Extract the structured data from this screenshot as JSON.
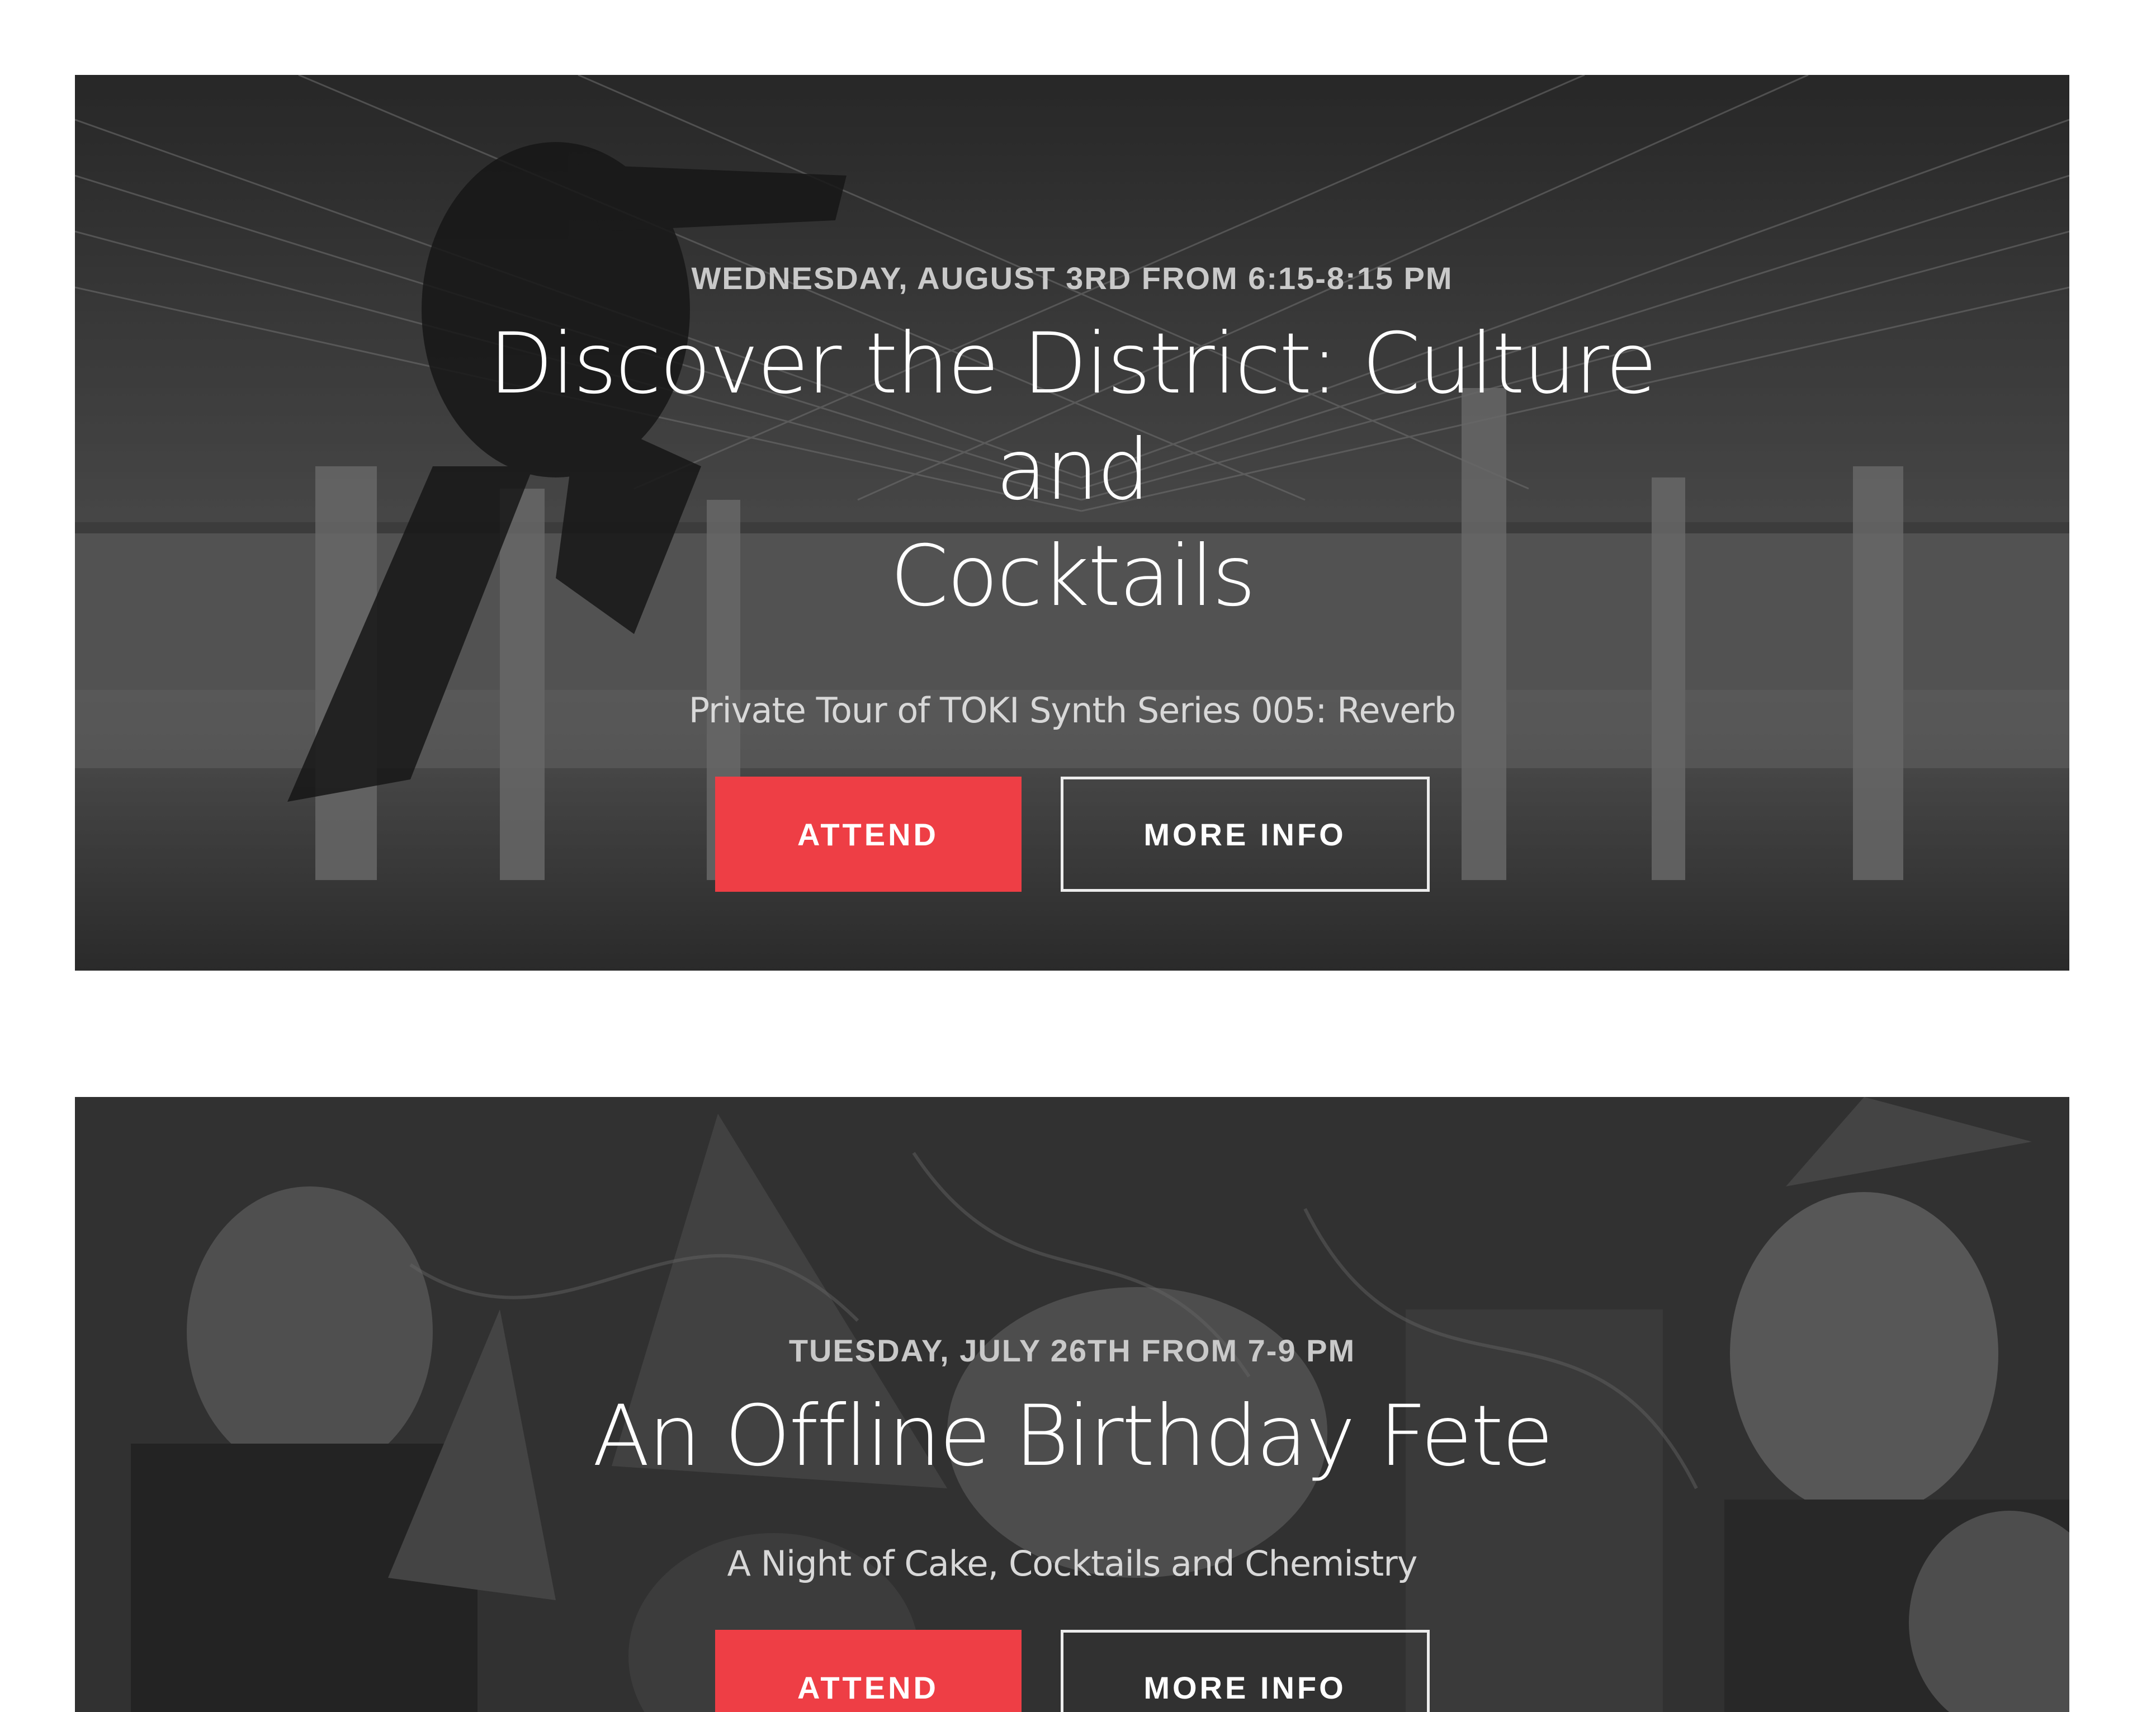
{
  "events": [
    {
      "date": "WEDNESDAY, AUGUST 3RD FROM 6:15-8:15 PM",
      "title_line1": "Discover the District: Culture and",
      "title_line2": "Cocktails",
      "subtitle": "Private Tour of TOKI Synth Series 005: Reverb",
      "attend_label": "ATTEND",
      "more_info_label": "MORE INFO"
    },
    {
      "date": "TUESDAY, JULY 26TH FROM 7-9 PM",
      "title_line1": "An Offline Birthday Fete",
      "subtitle": "A Night of Cake, Cocktails and Chemistry",
      "attend_label": "ATTEND",
      "more_info_label": "MORE INFO"
    }
  ],
  "colors": {
    "attend_button": "#ee3e45",
    "more_info_border": "#ececec",
    "page_background": "#ffffff"
  }
}
